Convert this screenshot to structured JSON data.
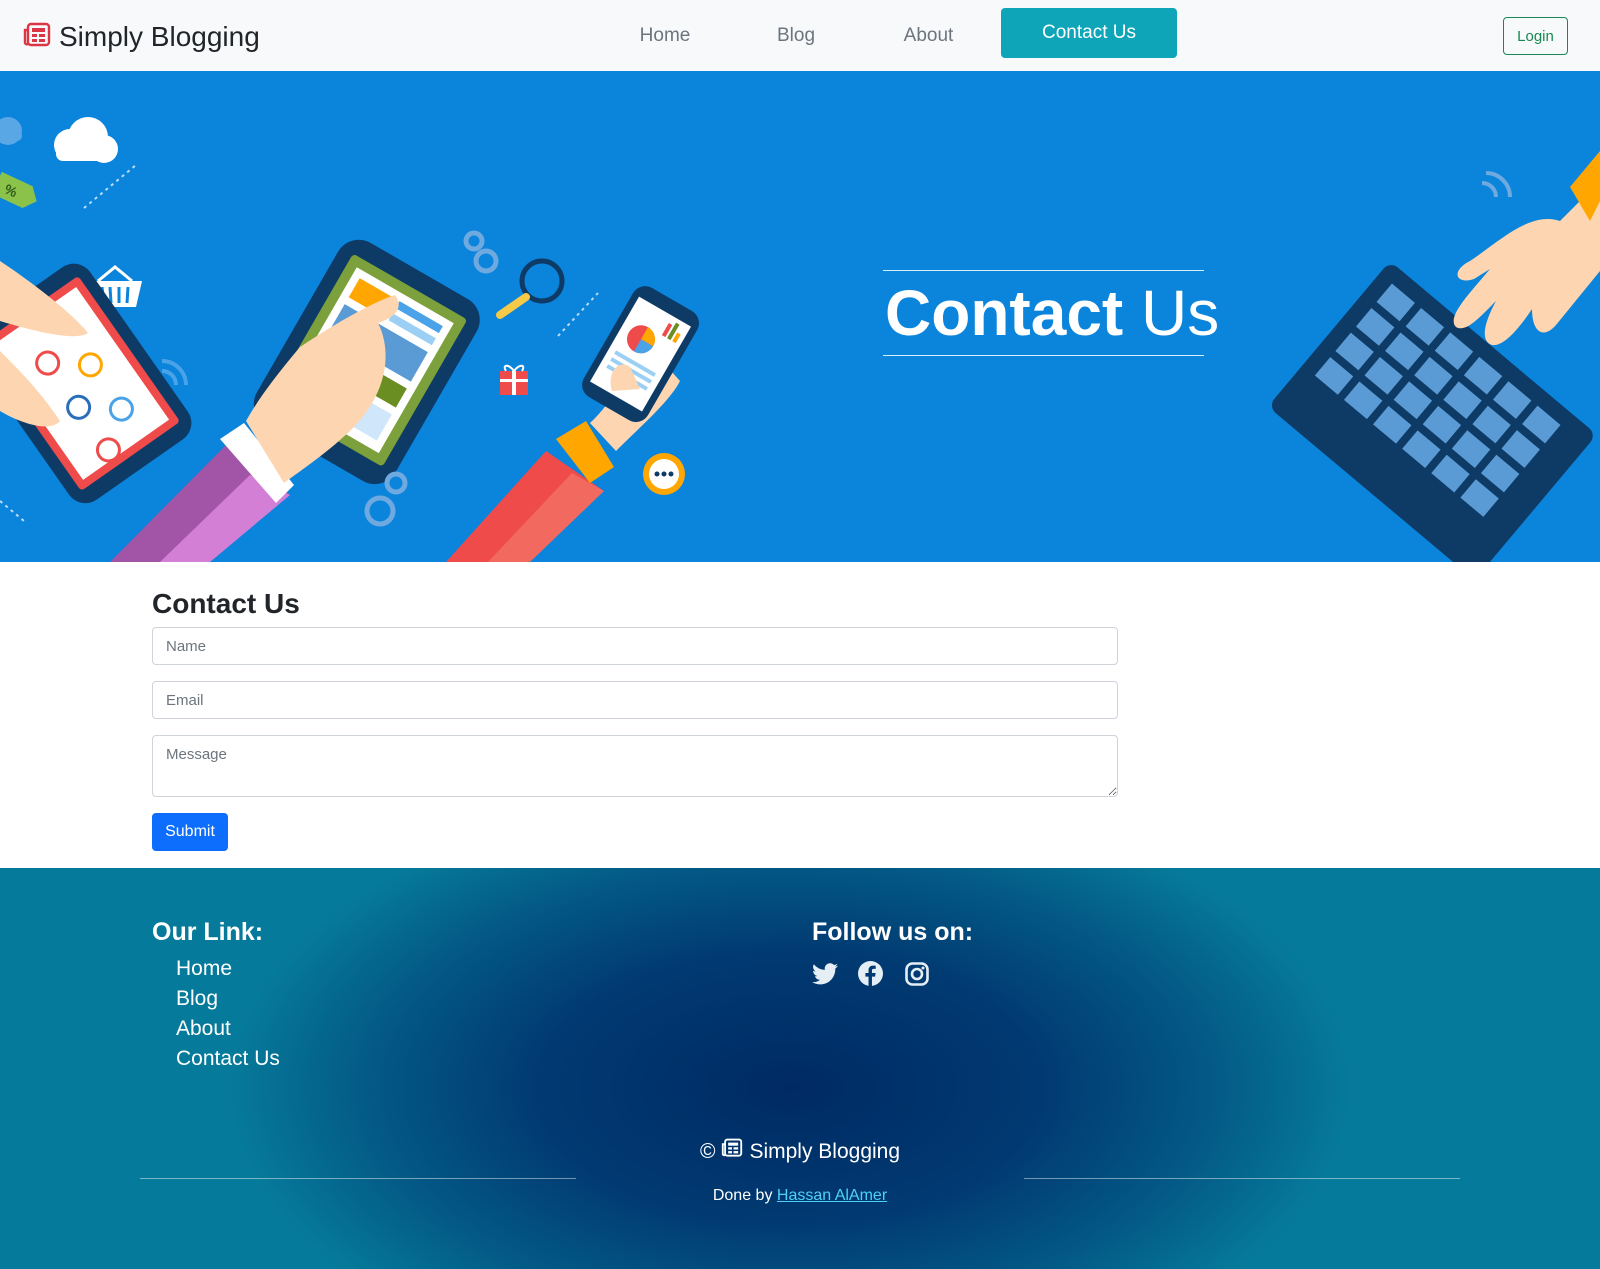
{
  "navbar": {
    "brand": "Simply Blogging",
    "links": [
      "Home",
      "Blog",
      "About"
    ],
    "active_link": "Contact Us",
    "login_label": "Login"
  },
  "hero": {
    "title_bold": "Contact",
    "title_light": "Us"
  },
  "contact_form": {
    "title": "Contact Us",
    "name_placeholder": "Name",
    "email_placeholder": "Email",
    "message_placeholder": "Message",
    "submit_label": "Submit"
  },
  "footer": {
    "links_heading": "Our Link:",
    "links": [
      "Home",
      "Blog",
      "About",
      "Contact Us"
    ],
    "follow_heading": "Follow us on:",
    "social_icons": [
      "twitter-icon",
      "facebook-icon",
      "instagram-icon"
    ],
    "copyright_symbol": "©",
    "copyright_brand": "Simply Blogging",
    "done_by_prefix": "Done by",
    "author": "Hassan AlAmer"
  },
  "colors": {
    "nav_active_bg": "#0ea5b9",
    "hero_bg": "#0b84dc",
    "submit_bg": "#0d6efd",
    "login_border": "#198754",
    "footer_center": "#002a63",
    "footer_edge": "#067a9a",
    "author_link": "#4fd1f5"
  }
}
